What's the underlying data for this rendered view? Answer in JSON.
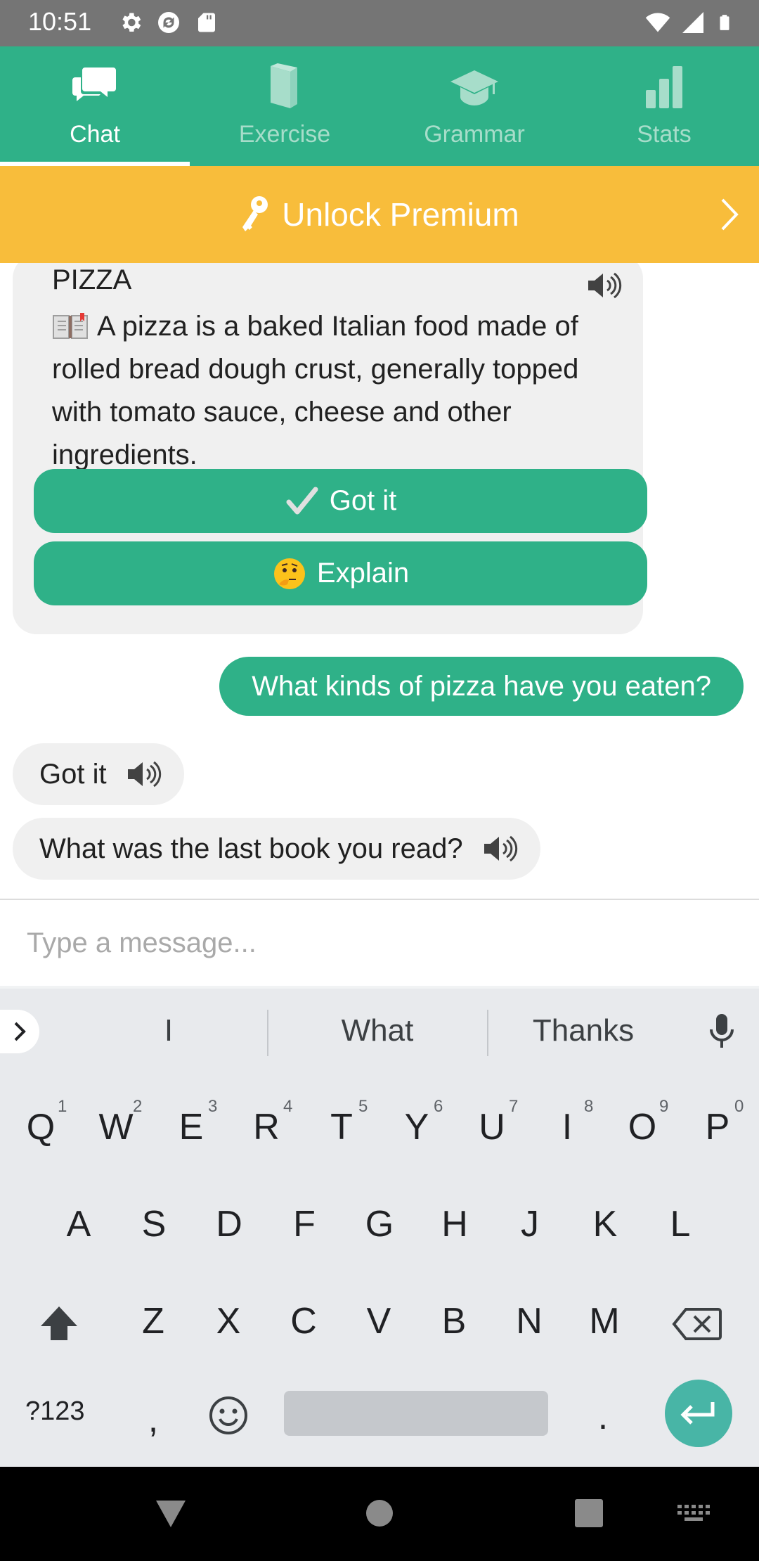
{
  "status_bar": {
    "time": "10:51",
    "left_icons": [
      "settings-icon",
      "sync-icon",
      "sd-card-icon"
    ],
    "right_icons": [
      "wifi-icon",
      "signal-icon",
      "battery-icon"
    ]
  },
  "tabs": [
    {
      "label": "Chat",
      "icon": "chat-icon",
      "active": true
    },
    {
      "label": "Exercise",
      "icon": "book-icon",
      "active": false
    },
    {
      "label": "Grammar",
      "icon": "graduation-cap-icon",
      "active": false
    },
    {
      "label": "Stats",
      "icon": "bar-chart-icon",
      "active": false
    }
  ],
  "premium_banner": {
    "label": "Unlock Premium",
    "icon": "key-icon"
  },
  "chat": {
    "word_card": {
      "title": "PIZZA",
      "definition": "A pizza is a baked Italian food made of rolled bread dough crust, generally topped with tomato sauce, cheese and other ingredients.",
      "got_it_label": "Got it",
      "explain_label": "Explain"
    },
    "user_message": "What kinds of pizza have you eaten?",
    "bot_messages": [
      {
        "text": "Got it"
      },
      {
        "text": "What was the last book you read?"
      }
    ]
  },
  "composer": {
    "placeholder": "Type a message...",
    "value": ""
  },
  "keyboard": {
    "suggestions": [
      "I",
      "What",
      "Thanks"
    ],
    "row1": [
      "Q",
      "W",
      "E",
      "R",
      "T",
      "Y",
      "U",
      "I",
      "O",
      "P"
    ],
    "row1_hints": [
      "1",
      "2",
      "3",
      "4",
      "5",
      "6",
      "7",
      "8",
      "9",
      "0"
    ],
    "row2": [
      "A",
      "S",
      "D",
      "F",
      "G",
      "H",
      "J",
      "K",
      "L"
    ],
    "row3": [
      "Z",
      "X",
      "C",
      "V",
      "B",
      "N",
      "M"
    ],
    "symbols_label": "?123",
    "comma": ",",
    "period": "."
  },
  "nav_bar": {
    "icons": [
      "back-icon",
      "home-icon",
      "recents-icon",
      "keyboard-switch-icon"
    ]
  },
  "colors": {
    "brand_green": "#2fb188",
    "premium_yellow": "#f8bd3b",
    "status_gray": "#757575",
    "keyboard_bg": "#e8eaed"
  }
}
